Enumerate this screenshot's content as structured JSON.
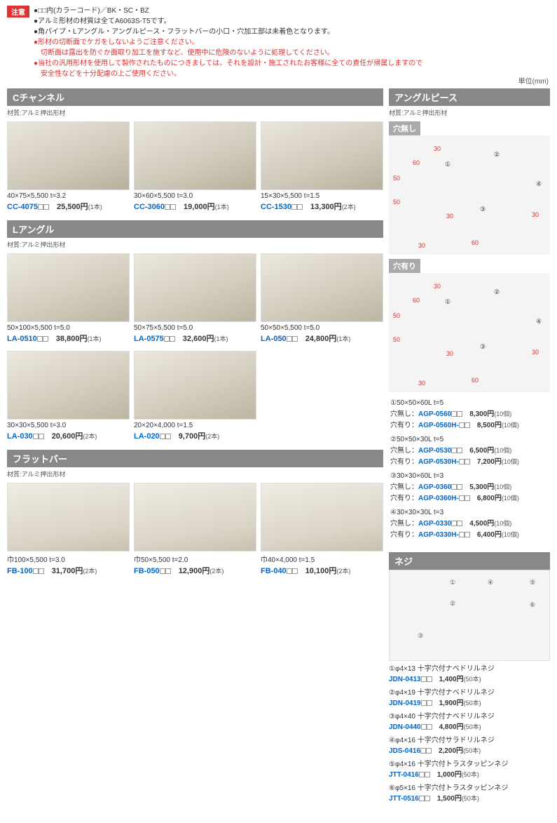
{
  "notice": {
    "badge": "注意",
    "lines": [
      {
        "text": "●□□内(カラーコード)／BK・SC・BZ",
        "red": false
      },
      {
        "text": "●アルミ形材の材質は全てA6063S-T5です。",
        "red": false
      },
      {
        "text": "●角パイプ・Lアングル・アングルピース・フラットバーの小口・穴加工部は未着色となります。",
        "red": false
      },
      {
        "text": "●形材の切断面でケガをしないようご注意ください。\n　切断面は露出を防ぐか面取り加工を施すなど、使用中に危険のないように処理してください。",
        "red": true
      },
      {
        "text": "●当社の汎用形材を使用して製作されたものにつきましては、それを設計・施工されたお客様に全ての責任が帰属しますので\n　安全性などを十分配慮の上ご使用ください。",
        "red": true
      }
    ]
  },
  "unit": "単位(mm)",
  "sections": {
    "cchannel": {
      "title": "Cチャンネル",
      "material": "材質:アルミ押出形材",
      "items": [
        {
          "spec": "40×75×5,500 t=3.2",
          "code": "CC-4075",
          "price": "25,500円",
          "qty": "(1本)"
        },
        {
          "spec": "30×60×5,500 t=3.0",
          "code": "CC-3060",
          "price": "19,000円",
          "qty": "(1本)"
        },
        {
          "spec": "15×30×5,500 t=1.5",
          "code": "CC-1530",
          "price": "13,300円",
          "qty": "(2本)"
        }
      ]
    },
    "langle": {
      "title": "Lアングル",
      "material": "材質:アルミ押出形材",
      "row1": [
        {
          "spec": "50×100×5,500 t=5.0",
          "code": "LA-0510",
          "price": "38,800円",
          "qty": "(1本)"
        },
        {
          "spec": "50×75×5,500 t=5.0",
          "code": "LA-0575",
          "price": "32,600円",
          "qty": "(1本)"
        },
        {
          "spec": "50×50×5,500 t=5.0",
          "code": "LA-050",
          "price": "24,800円",
          "qty": "(1本)"
        }
      ],
      "row2": [
        {
          "spec": "30×30×5,500 t=3.0",
          "code": "LA-030",
          "price": "20,600円",
          "qty": "(2本)"
        },
        {
          "spec": "20×20×4,000 t=1.5",
          "code": "LA-020",
          "price": "9,700円",
          "qty": "(2本)"
        }
      ]
    },
    "flatbar": {
      "title": "フラットバー",
      "material": "材質:アルミ押出形材",
      "items": [
        {
          "spec": "巾100×5,500 t=3.0",
          "code": "FB-100",
          "price": "31,700円",
          "qty": "(2本)"
        },
        {
          "spec": "巾50×5,500 t=2.0",
          "code": "FB-050",
          "price": "12,900円",
          "qty": "(2本)"
        },
        {
          "spec": "巾40×4,000 t=1.5",
          "code": "FB-040",
          "price": "10,100円",
          "qty": "(2本)"
        }
      ]
    },
    "anglepiece": {
      "title": "アングルピース",
      "material": "材質:アルミ押出形材",
      "nohole_label": "穴無し",
      "hole_label": "穴有り",
      "nohole_label2": "穴無し：",
      "hole_label2": "穴有り：",
      "specs": [
        {
          "title": "①50×50×60L t=5",
          "nohole": {
            "code": "AGP-0560",
            "price": "8,300円",
            "qty": "(10個)"
          },
          "hole": {
            "code": "AGP-0560H-",
            "price": "8,500円",
            "qty": "(10個)"
          }
        },
        {
          "title": "②50×50×30L t=5",
          "nohole": {
            "code": "AGP-0530",
            "price": "6,500円",
            "qty": "(10個)"
          },
          "hole": {
            "code": "AGP-0530H-",
            "price": "7,200円",
            "qty": "(10個)"
          }
        },
        {
          "title": "③30×30×60L t=3",
          "nohole": {
            "code": "AGP-0360",
            "price": "5,300円",
            "qty": "(10個)"
          },
          "hole": {
            "code": "AGP-0360H-",
            "price": "6,800円",
            "qty": "(10個)"
          }
        },
        {
          "title": "④30×30×30L t=3",
          "nohole": {
            "code": "AGP-0330",
            "price": "4,500円",
            "qty": "(10個)"
          },
          "hole": {
            "code": "AGP-0330H-",
            "price": "6,400円",
            "qty": "(10個)"
          }
        }
      ]
    },
    "screws": {
      "title": "ネジ",
      "items": [
        {
          "desc": "①φ4×13 十字穴付ナベドリルネジ",
          "code": "JDN-0413",
          "price": "1,400円",
          "qty": "(50本)"
        },
        {
          "desc": "②φ4×19 十字穴付ナベドリルネジ",
          "code": "JDN-0419",
          "price": "1,900円",
          "qty": "(50本)"
        },
        {
          "desc": "③φ4×40 十字穴付ナベドリルネジ",
          "code": "JDN-0440",
          "price": "4,800円",
          "qty": "(50本)"
        },
        {
          "desc": "④φ4×16 十字穴付サラドリルネジ",
          "code": "JDS-0416",
          "price": "2,200円",
          "qty": "(50本)"
        },
        {
          "desc": "⑤φ4×16 十字穴付トラスタッピンネジ",
          "code": "JTT-0416",
          "price": "1,000円",
          "qty": "(50本)"
        },
        {
          "desc": "⑥φ5×16 十字穴付トラスタッピンネジ",
          "code": "JTT-0516",
          "price": "1,500円",
          "qty": "(50本)"
        }
      ]
    }
  },
  "diagram_labels": {
    "dims_nohole": [
      "30",
      "60",
      "50",
      "50",
      "30",
      "30",
      "60",
      "30",
      "①",
      "②",
      "③",
      "④"
    ],
    "dims_hole": [
      "30",
      "60",
      "50",
      "50",
      "30",
      "30",
      "60",
      "30",
      "①",
      "②",
      "③",
      "④"
    ],
    "screw_nums": [
      "①",
      "②",
      "③",
      "④",
      "⑤",
      "⑥"
    ]
  }
}
